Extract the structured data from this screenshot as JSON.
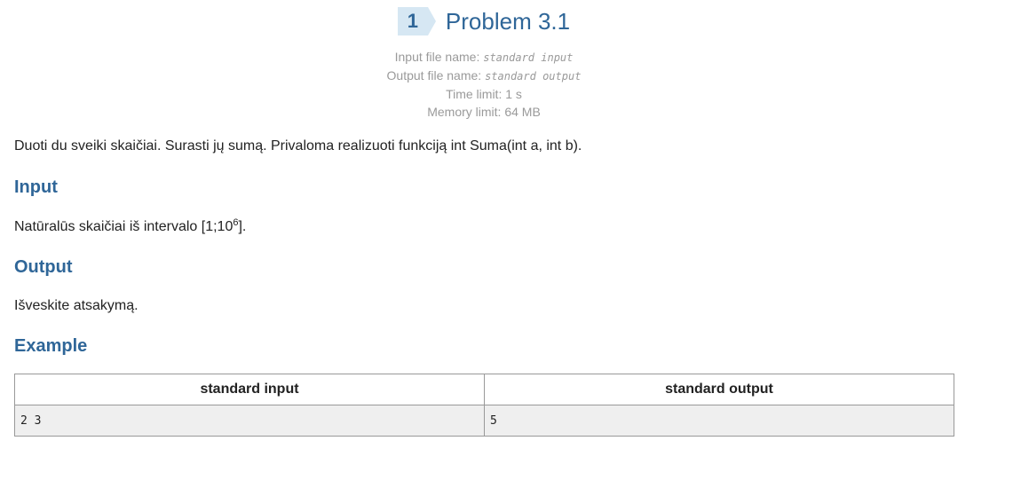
{
  "problem": {
    "number": "1",
    "title": "Problem 3.1"
  },
  "meta": {
    "input_file_label": "Input file name:",
    "input_file_value": "standard input",
    "output_file_label": "Output file name:",
    "output_file_value": "standard output",
    "time_limit": "Time limit: 1 s",
    "memory_limit": "Memory limit: 64 MB"
  },
  "statement": "Duoti du sveiki skaičiai. Surasti jų sumą. Privaloma realizuoti funkciją int Suma(int a, int b).",
  "input_section": {
    "heading": "Input",
    "text_before": "Natūralūs skaičiai iš intervalo [1;10",
    "exponent": "6",
    "text_after": "]."
  },
  "output_section": {
    "heading": "Output",
    "text": "Išveskite atsakymą."
  },
  "example": {
    "heading": "Example",
    "columns": [
      "standard input",
      "standard output"
    ],
    "rows": [
      [
        "2 3",
        "5"
      ]
    ]
  },
  "colors": {
    "accent": "#2f6698",
    "badge_bg": "#d6e7f3",
    "meta_text": "#9a9a9a",
    "table_cell_bg": "#efefef",
    "table_border": "#999999"
  }
}
